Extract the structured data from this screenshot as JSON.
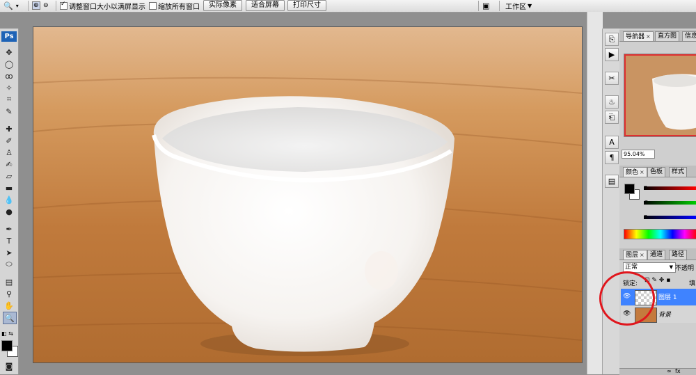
{
  "options_bar": {
    "fit_window_label": "调整窗口大小以满屏显示",
    "fit_window_checked": true,
    "zoom_all_label": "缩放所有窗口",
    "zoom_all_checked": false,
    "actual_pixels_label": "实际像素",
    "fit_screen_label": "适合屏幕",
    "print_size_label": "打印尺寸",
    "workspace_label": "工作区"
  },
  "toolbox": {
    "logo": "Ps"
  },
  "navigator_panel": {
    "tabs": [
      "导航器",
      "直方图",
      "信息"
    ],
    "zoom_value": "95.04%"
  },
  "color_panel": {
    "tabs": [
      "颜色",
      "色板",
      "样式"
    ],
    "channels": [
      "R",
      "G",
      "B"
    ],
    "foreground": "#000000",
    "background": "#ffffff"
  },
  "layers_panel": {
    "tabs": [
      "图层",
      "通道",
      "路径"
    ],
    "blend_mode": "正常",
    "opacity_label": "不透明",
    "lock_label": "锁定:",
    "fill_label": "填",
    "layers": [
      {
        "name": "图层 1",
        "selected": true
      },
      {
        "name": "背景",
        "selected": false
      }
    ]
  },
  "colors": {
    "selection_blue": "#3f83ff",
    "annotation_red": "#e0161d",
    "ps_blue": "#1e63b6"
  }
}
